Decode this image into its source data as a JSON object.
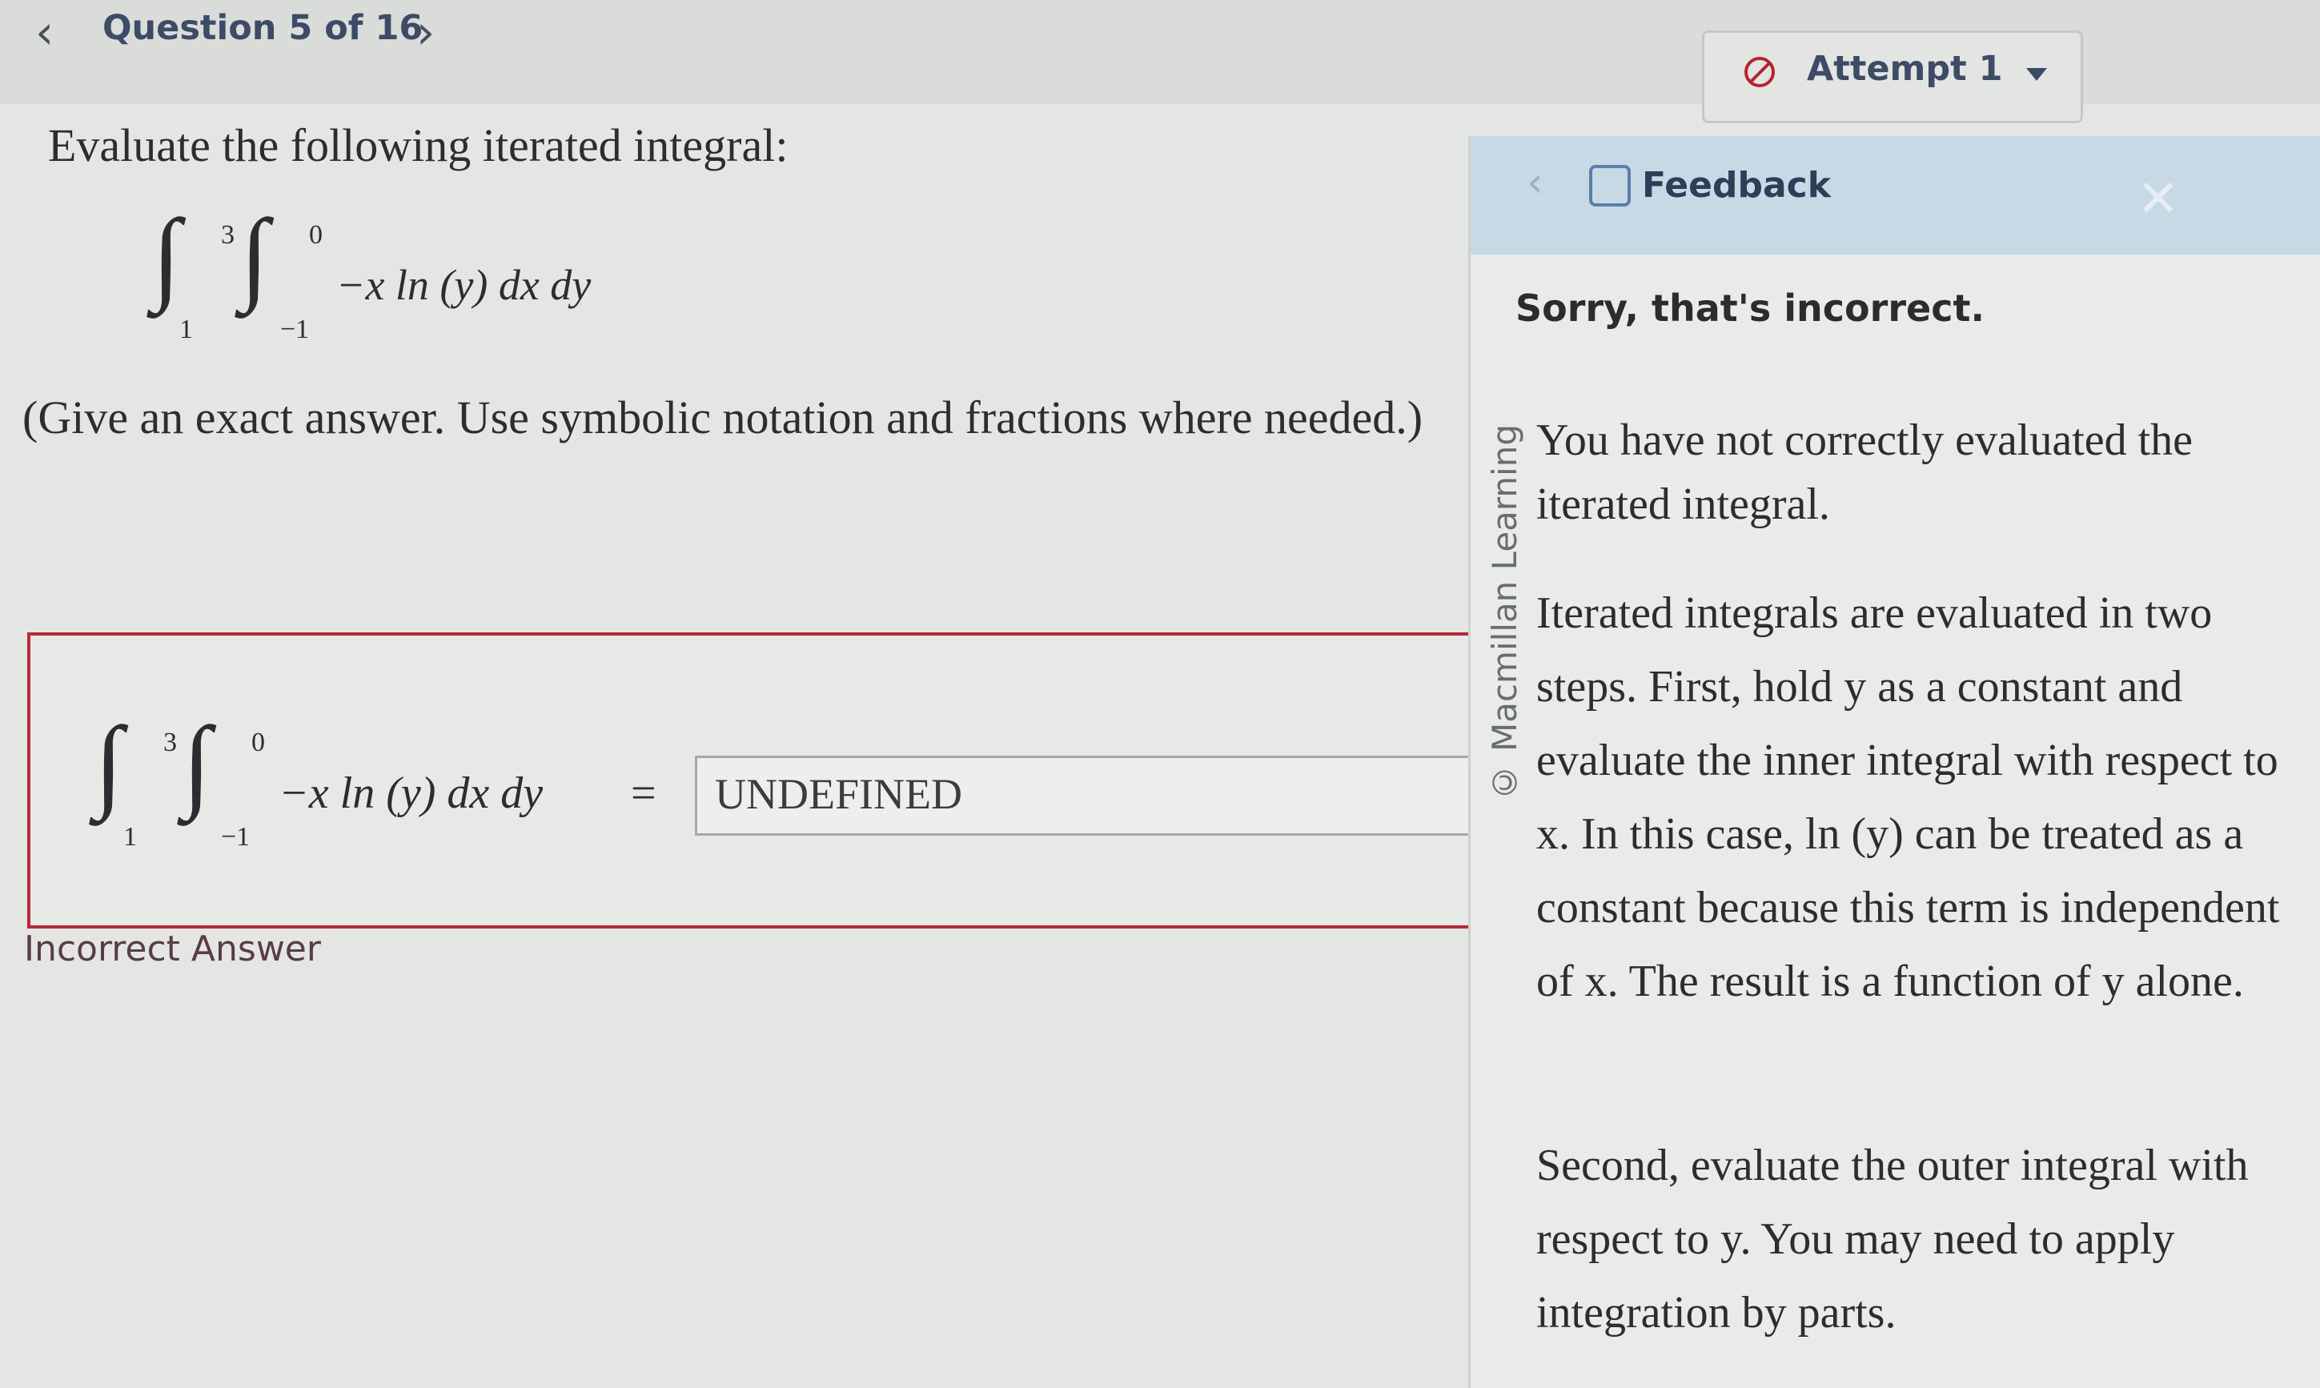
{
  "topbar": {
    "prev_icon": "chevron-left-icon",
    "question_title": "Question 5 of 16",
    "next_icon": "chevron-right-icon",
    "attempt_label": "Attempt 1",
    "attempt_icon": "no-entry-circle-icon"
  },
  "question": {
    "prompt": "Evaluate the following iterated integral:",
    "integral": {
      "outer_upper": "3",
      "outer_lower": "1",
      "inner_upper": "0",
      "inner_lower": "−1",
      "integrand": "−x ln (y) dx dy"
    },
    "instructions": "(Give an exact answer. Use symbolic notation and fractions where needed.)",
    "answer_equation_suffix": "=",
    "answer_value": "UNDEFINED",
    "status_label": "Incorrect Answer"
  },
  "feedback": {
    "title": "Feedback",
    "status": "Sorry, that's incorrect.",
    "paragraph1": "You have not correctly evaluated the iterated integral.",
    "paragraph2": "Iterated integrals are evaluated in two steps. First, hold y as a constant and evaluate the inner integral with respect to x. In this case, ln (y) can be treated as a constant because this term is independent of x. The result is a function of y alone.",
    "paragraph3": "Second, evaluate the outer integral with respect to y. You may need to apply integration by parts.",
    "watermark": "© Macmillan Learning"
  },
  "colors": {
    "error_red": "#b62a38",
    "nav_blue": "#3d4b66",
    "feedback_header": "#c7d9e4"
  }
}
